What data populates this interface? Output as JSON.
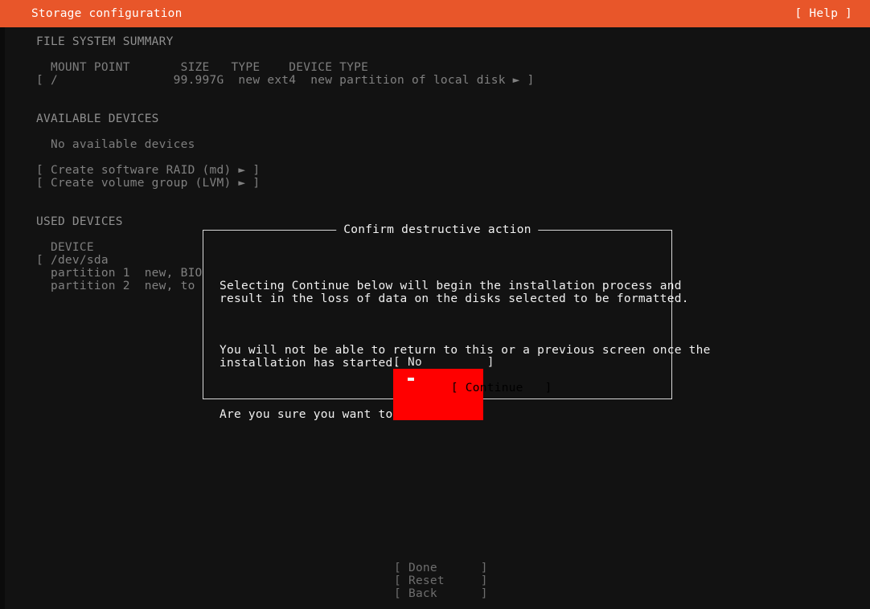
{
  "header": {
    "title": "Storage configuration",
    "help_label": "[ Help ]"
  },
  "filesystem_summary": {
    "section_label": "FILE SYSTEM SUMMARY",
    "columns": "  MOUNT POINT       SIZE   TYPE    DEVICE TYPE",
    "rows": [
      "[ /                99.997G  new ext4  new partition of local disk ► ]"
    ]
  },
  "available_devices": {
    "section_label": "AVAILABLE DEVICES",
    "empty_message": "  No available devices",
    "actions": [
      "[ Create software RAID (md) ► ]",
      "[ Create volume group (LVM) ► ]"
    ]
  },
  "used_devices": {
    "section_label": "USED DEVICES",
    "columns": "  DEVICE",
    "rows": [
      "[ /dev/sda",
      "  partition 1  new, BIO",
      "  partition 2  new, to"
    ]
  },
  "dialog": {
    "title": "Confirm destructive action",
    "paragraphs": [
      "Selecting Continue below will begin the installation process and\nresult in the loss of data on the disks selected to be formatted.",
      "You will not be able to return to this or a previous screen once the\ninstallation has started.",
      "Are you sure you want to continue?"
    ],
    "buttons": [
      {
        "label": "[ No         ]",
        "selected": false
      },
      {
        "label": "[ Continue   ]",
        "selected": true
      }
    ]
  },
  "footer": {
    "buttons": [
      "[ Done      ]",
      "[ Reset     ]",
      "[ Back      ]"
    ]
  },
  "colors": {
    "accent": "#e8562a",
    "background": "#121212",
    "danger": "#ff0000",
    "text_dim": "#808080",
    "text_bright": "#f0f0f0"
  }
}
